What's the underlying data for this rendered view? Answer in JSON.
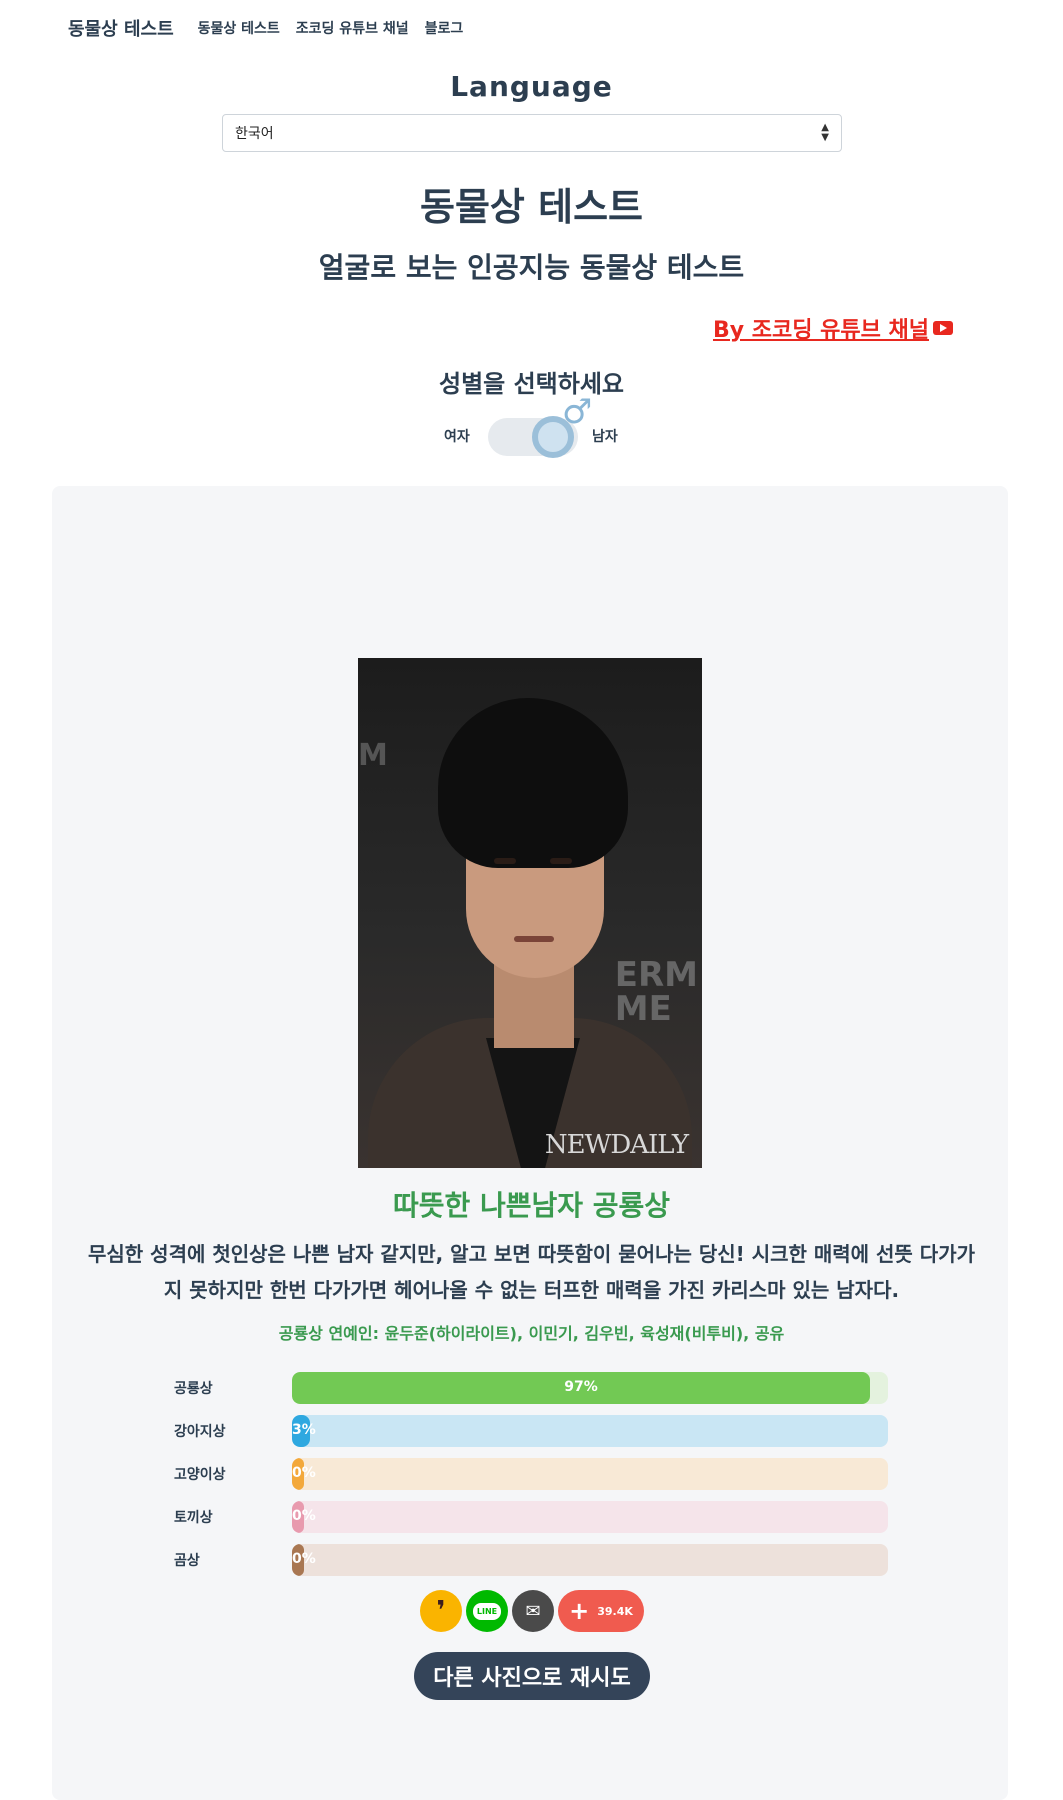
{
  "nav": {
    "brand": "동물상 테스트",
    "links": [
      "동물상 테스트",
      "조코딩 유튜브 채널",
      "블로그"
    ]
  },
  "language": {
    "title": "Language",
    "selected": "한국어"
  },
  "header": {
    "title": "동물상 테스트",
    "subtitle": "얼굴로 보는 인공지능 동물상 테스트",
    "by_link": "By 조코딩 유튜브 채널"
  },
  "gender": {
    "prompt": "성별을 선택하세요",
    "female": "여자",
    "male": "남자",
    "selected": "male"
  },
  "photo": {
    "wall_left": "M",
    "wall_right": "ERM\nME",
    "watermark": "NEWDAILY"
  },
  "result": {
    "title": "따뜻한 나쁜남자 공룡상",
    "description": "무심한 성격에 첫인상은 나쁜 남자 같지만, 알고 보면 따뜻함이 묻어나는 당신! 시크한 매력에 선뜻 다가가지 못하지만 한번 다가가면 헤어나올 수 없는 터프한 매력을 가진 카리스마 있는 남자다.",
    "celebrities": "공룡상 연예인: 윤두준(하이라이트), 이민기, 김우빈, 육성재(비투비), 공유"
  },
  "bars": [
    {
      "label": "공룡상",
      "percent": 97,
      "text": "97%",
      "color": "#72c954",
      "track": "#e4f2de"
    },
    {
      "label": "강아지상",
      "percent": 3,
      "text": "3%",
      "color": "#2ea8e0",
      "track": "#c9e6f4"
    },
    {
      "label": "고양이상",
      "percent": 0,
      "text": "0%",
      "color": "#f3a83a",
      "track": "#f8e9d6"
    },
    {
      "label": "토끼상",
      "percent": 0,
      "text": "0%",
      "color": "#e89aae",
      "track": "#f5e4ea"
    },
    {
      "label": "곰상",
      "percent": 0,
      "text": "0%",
      "color": "#a97752",
      "track": "#ede1db"
    }
  ],
  "share": {
    "count": "39.4K"
  },
  "retry_label": "다른 사진으로 재시도"
}
